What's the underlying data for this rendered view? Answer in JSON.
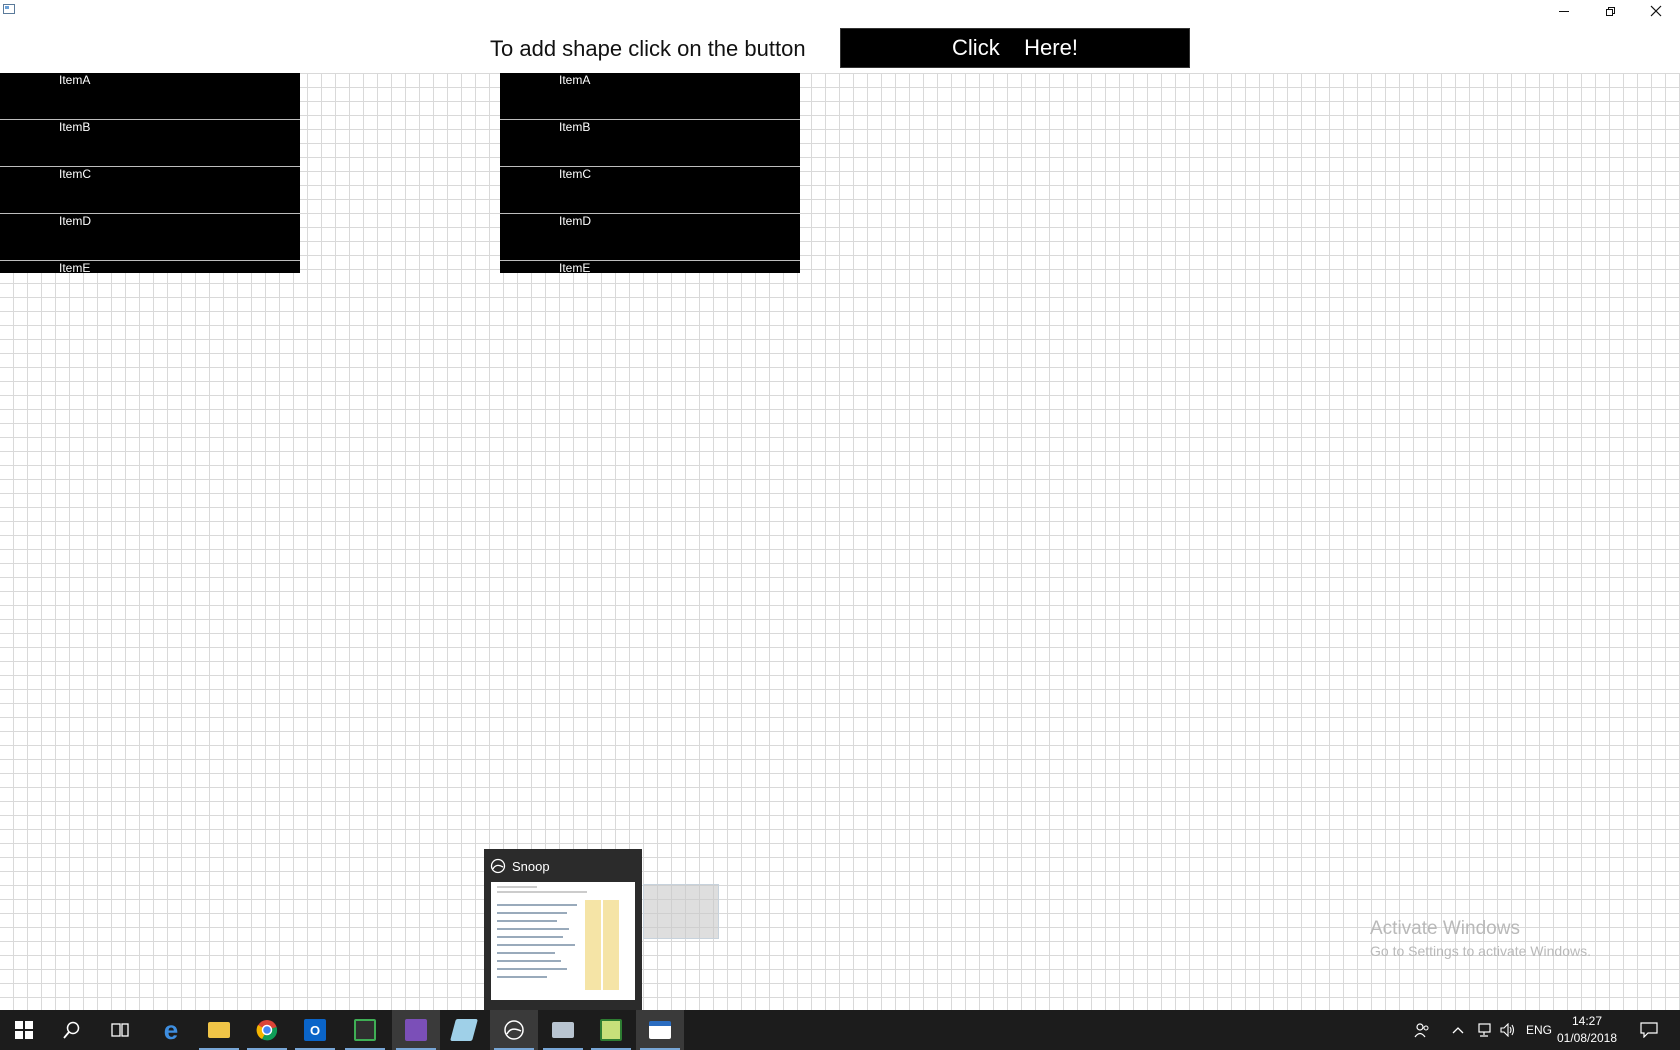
{
  "window": {
    "controls": [
      "minimize",
      "restore",
      "close"
    ]
  },
  "header": {
    "prompt": "To add shape click on the button",
    "button_label": "Click    Here!"
  },
  "shapes": [
    {
      "items": [
        "ItemA",
        "ItemB",
        "ItemC",
        "ItemD",
        "ItemE"
      ]
    },
    {
      "items": [
        "ItemA",
        "ItemB",
        "ItemC",
        "ItemD",
        "ItemE"
      ]
    }
  ],
  "watermark": {
    "title": "Activate Windows",
    "subtitle": "Go to Settings to activate Windows."
  },
  "preview": {
    "title": "Snoop"
  },
  "taskbar": {
    "apps": [
      "start-icon",
      "search-icon",
      "task-view-icon",
      "edge-icon",
      "file-explorer-icon",
      "chrome-icon",
      "outlook-icon",
      "calculator-app-icon",
      "visual-studio-icon",
      "notes-app-icon",
      "snoop-icon",
      "scanner-app-icon",
      "spreadsheet-app-icon",
      "window-app-icon"
    ],
    "language": "ENG",
    "time": "14:27",
    "date": "01/08/2018"
  },
  "colors": {
    "background": "#ffffff",
    "grid": "#d9d9d9",
    "shape_fill": "#000000",
    "taskbar": "#1c1c1c",
    "accent": "#78a6d6"
  }
}
